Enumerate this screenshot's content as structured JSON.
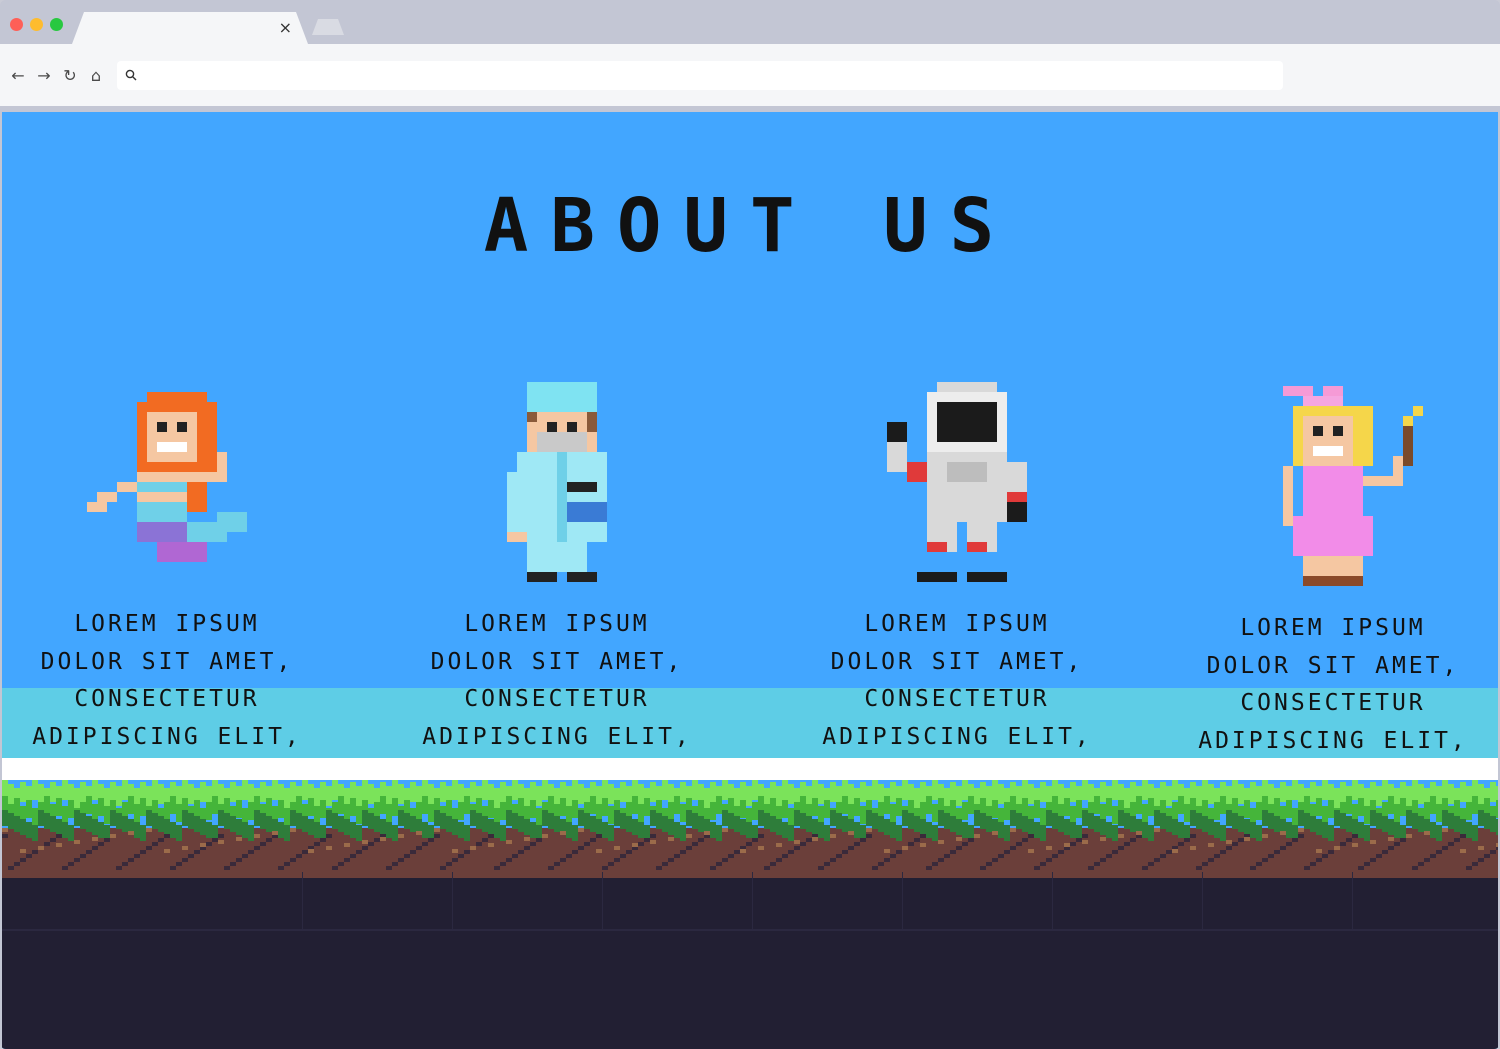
{
  "browser": {
    "tab_close": "×",
    "address_value": "",
    "nav": {
      "back": "←",
      "forward": "→",
      "reload": "↻",
      "home": "⌂"
    }
  },
  "page": {
    "title": "ABOUT US",
    "cards": [
      {
        "character": "mermaid-sprite",
        "text": "LOREM IPSUM\nDOLOR SIT AMET,\nCONSECTETUR\nADIPISCING ELIT,"
      },
      {
        "character": "doctor-sprite",
        "text": "LOREM IPSUM\nDOLOR SIT AMET,\nCONSECTETUR\nADIPISCING ELIT,"
      },
      {
        "character": "astronaut-sprite",
        "text": "LOREM IPSUM\nDOLOR SIT AMET,\nCONSECTETUR\nADIPISCING ELIT,"
      },
      {
        "character": "fairy-sprite",
        "text": "LOREM IPSUM\nDOLOR SIT AMET,\nCONSECTETUR\nADIPISCING ELIT,"
      }
    ]
  },
  "colors": {
    "sky": "#42a6ff",
    "shelf": "#5ecde6",
    "grass_light": "#7be35a",
    "grass_mid": "#45b53a",
    "grass_dark": "#2e7d3a",
    "dirt": "#6b3f3a",
    "underground": "#221f33"
  }
}
